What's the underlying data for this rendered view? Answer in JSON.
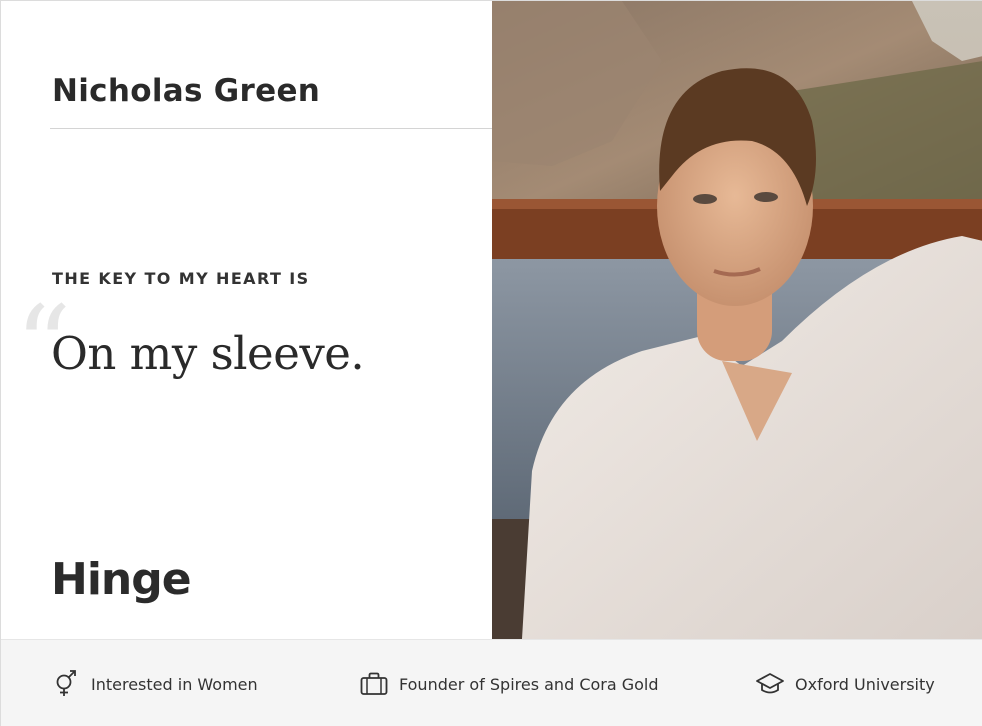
{
  "profile": {
    "name": "Nicholas Green",
    "prompt": "THE KEY TO MY HEART IS",
    "quote_mark": "“",
    "answer": "On my sleeve.",
    "logo": "Hinge"
  },
  "footer": {
    "items": [
      {
        "icon": "gender-icon",
        "label": "Interested in Women"
      },
      {
        "icon": "briefcase-icon",
        "label": "Founder of Spires and Cora Gold"
      },
      {
        "icon": "graduation-cap-icon",
        "label": "Oxford University"
      }
    ]
  },
  "colors": {
    "text": "#2b2b2b",
    "footer_bg": "#f5f5f5",
    "divider": "#d4d4d4"
  }
}
